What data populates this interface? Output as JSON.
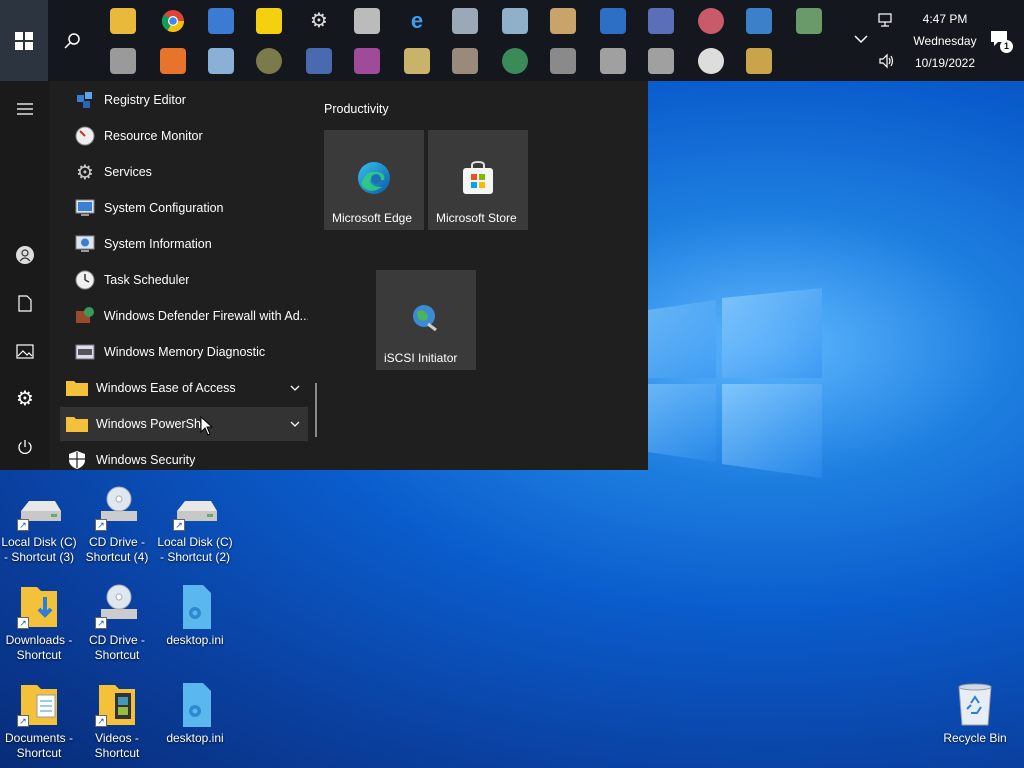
{
  "taskbar": {
    "tray_icons_row1": [
      "folder-icon",
      "chrome-icon",
      "media-icon",
      "sticky-notes-icon",
      "settings-icon",
      "tag-icon",
      "ie-icon",
      "pen-icon",
      "tablet-icon",
      "paint-icon",
      "remote-desktop-icon",
      "computer-management-icon",
      "cloud-icon",
      "network-icon",
      "control-panel-icon"
    ],
    "tray_icons_row2": [
      "printer-icon",
      "media-player-icon",
      "picture-icon",
      "disk-icon",
      "pc-icon",
      "package-icon",
      "cassette-icon",
      "tower-icon",
      "globe-icon",
      "server-icon",
      "drive-icon",
      "drive2-icon",
      "compass-icon",
      "tools-icon"
    ],
    "clock": {
      "time": "4:47 PM",
      "day": "Wednesday",
      "date": "10/19/2022"
    },
    "notification_count": "1"
  },
  "start_menu": {
    "apps": [
      {
        "label": "Registry Editor",
        "icon": "registry-icon"
      },
      {
        "label": "Resource Monitor",
        "icon": "gauge-icon"
      },
      {
        "label": "Services",
        "icon": "gears-icon"
      },
      {
        "label": "System Configuration",
        "icon": "syscfg-icon"
      },
      {
        "label": "System Information",
        "icon": "sysinfo-icon"
      },
      {
        "label": "Task Scheduler",
        "icon": "clock-icon"
      },
      {
        "label": "Windows Defender Firewall with Ad...",
        "icon": "firewall-icon"
      },
      {
        "label": "Windows Memory Diagnostic",
        "icon": "memory-icon"
      },
      {
        "label": "Windows Ease of Access",
        "icon": "folder-icon"
      },
      {
        "label": "Windows PowerShell",
        "icon": "folder-icon"
      },
      {
        "label": "Windows Security",
        "icon": "shield-icon"
      }
    ],
    "group_title": "Productivity",
    "tiles": [
      {
        "label": "Microsoft Edge"
      },
      {
        "label": "Microsoft Store"
      },
      {
        "label": "iSCSI Initiator"
      }
    ]
  },
  "desktop": {
    "icons": [
      {
        "label": "Local Disk (C) - Shortcut (3)"
      },
      {
        "label": "CD Drive - Shortcut (4)"
      },
      {
        "label": "Local Disk (C) - Shortcut (2)"
      },
      {
        "label": "Downloads - Shortcut"
      },
      {
        "label": "CD Drive - Shortcut"
      },
      {
        "label": "desktop.ini"
      },
      {
        "label": "Documents - Shortcut"
      },
      {
        "label": "Videos - Shortcut"
      },
      {
        "label": "desktop.ini"
      },
      {
        "label": "Recycle Bin"
      }
    ]
  }
}
